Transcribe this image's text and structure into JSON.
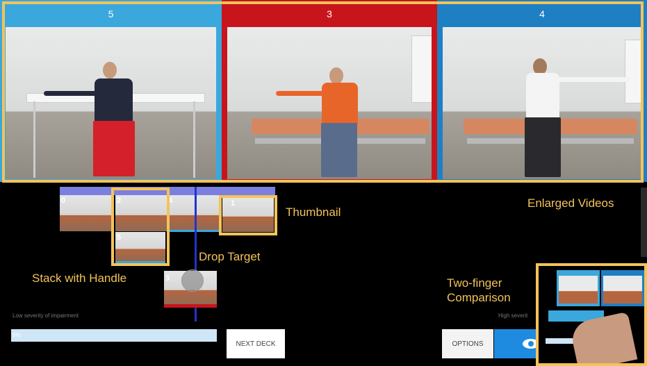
{
  "panels": [
    {
      "number": "5",
      "color": "#3aa8dc"
    },
    {
      "number": "3",
      "color": "#c8151b"
    },
    {
      "number": "4",
      "color": "#1f7fc3"
    }
  ],
  "thumbnails": {
    "t0": "0",
    "t2": "2",
    "t4": "4",
    "t1": "1",
    "t5": "5",
    "t3": "3"
  },
  "annotations": {
    "thumbnail": "Thumbnail",
    "enlarged": "Enlarged Videos",
    "drop_target": "Drop Target",
    "stack": "Stack with Handle",
    "two_finger_line1": "Two-finger",
    "two_finger_line2": "Comparison"
  },
  "severity": {
    "low": "Low severity of impairment",
    "high": "High severit"
  },
  "progress": {
    "label": "0%",
    "value": 0
  },
  "buttons": {
    "next_deck": "NEXT DECK",
    "options": "OPTIONS"
  },
  "colors": {
    "highlight": "#f3c35a",
    "blue": "#1f7fc3",
    "red": "#c8151b",
    "cyan": "#3aa8dc",
    "lavender": "#7b7fe0"
  },
  "icons": {
    "view": "eye-icon"
  }
}
